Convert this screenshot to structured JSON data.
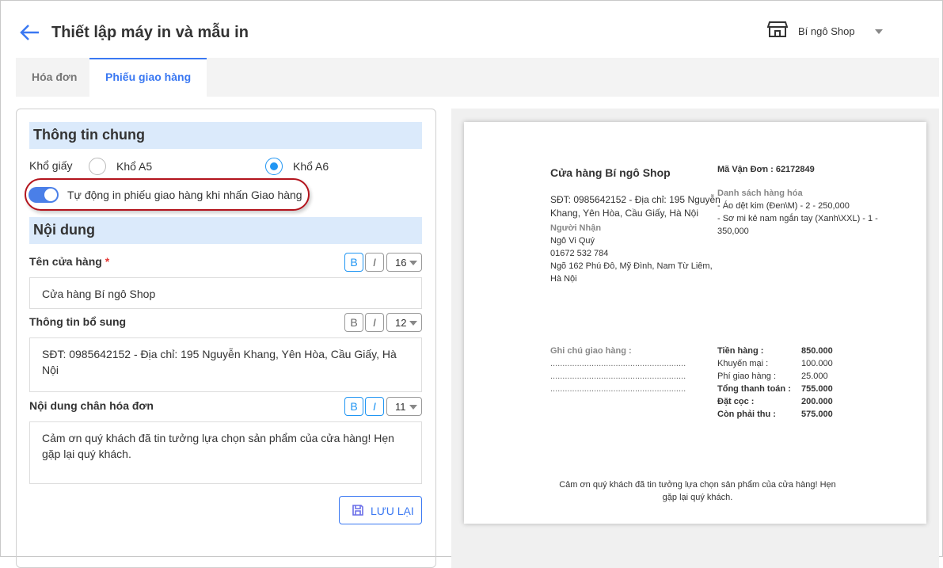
{
  "header": {
    "title": "Thiết lập máy in và mẫu in",
    "shop_name": "Bí ngô Shop"
  },
  "tabs": [
    {
      "label": "Hóa đơn"
    },
    {
      "label": "Phiếu giao hàng"
    }
  ],
  "general": {
    "heading": "Thông tin chung",
    "paper_label": "Khổ giấy",
    "option_a5": "Khổ A5",
    "option_a6": "Khổ A6",
    "selected": "Khổ A6",
    "auto_print_label": "Tự động in phiếu giao hàng khi nhấn Giao hàng",
    "auto_print_on": true
  },
  "content": {
    "heading": "Nội dung",
    "store_name": {
      "label": "Tên cửa hàng",
      "required": "*",
      "bold": "B",
      "italic": "I",
      "size": "16",
      "value": "Cửa hàng Bí ngô Shop"
    },
    "extra_info": {
      "label": "Thông tin bổ sung",
      "bold": "B",
      "italic": "I",
      "size": "12",
      "value": "SĐT: 0985642152 - Địa chỉ: 195 Nguyễn Khang, Yên Hòa, Cầu Giấy, Hà Nội"
    },
    "footer": {
      "label": "Nội dung chân hóa đơn",
      "bold": "B",
      "italic": "I",
      "size": "11",
      "value": "Cảm ơn quý khách đã tin tưởng lựa chọn sản phẩm của cửa hàng! Hẹn gặp lại quý khách."
    },
    "save_label": "LƯU LẠI"
  },
  "preview": {
    "store": "Cửa hàng Bí ngô Shop",
    "info": "SĐT: 0985642152 - Địa chỉ: 195 Nguyễn Khang, Yên Hòa, Cầu Giấy, Hà Nội",
    "recipient_label": "Người Nhận",
    "recipient_name": "Ngô Vi Quý",
    "recipient_phone": "01672 532 784",
    "recipient_address": "Ngõ 162 Phú Đô, Mỹ Đình, Nam Từ Liêm, Hà Nội",
    "waybill": "Mã Vận Đơn : 62172849",
    "goods_label": "Danh sách hàng hóa",
    "goods": [
      "- Áo dệt kim (Đen\\M) - 2 - 250,000",
      "- Sơ mi kẻ nam ngắn tay (Xanh\\XXL) - 1 - 350,000"
    ],
    "note_label": "Ghi chú giao hàng :",
    "note_lines": [
      "........................................................",
      "........................................................",
      "........................................................"
    ],
    "totals": [
      {
        "label": "Tiền hàng :",
        "value": "850.000",
        "bold": true
      },
      {
        "label": "Khuyến mại :",
        "value": "100.000",
        "bold": false
      },
      {
        "label": "Phí giao hàng :",
        "value": "25.000",
        "bold": false
      },
      {
        "label": "Tổng thanh toán :",
        "value": "755.000",
        "bold": true
      },
      {
        "label": "Đặt cọc :",
        "value": "200.000",
        "bold": true
      },
      {
        "label": "Còn phải thu :",
        "value": "575.000",
        "bold": true
      }
    ],
    "footer": "Cảm ơn quý khách đã tin tưởng lựa chọn sản phẩm của cửa hàng! Hẹn gặp lại quý khách."
  }
}
